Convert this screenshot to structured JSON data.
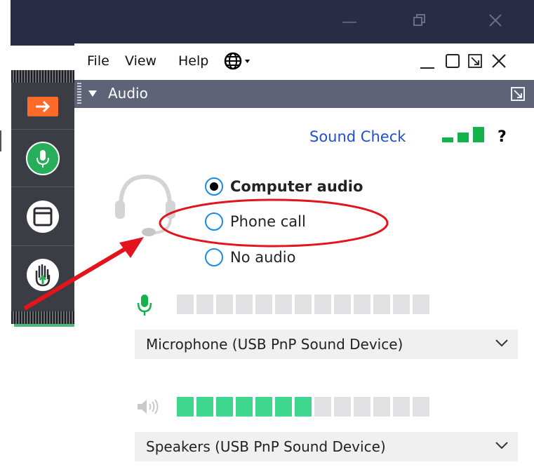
{
  "menu": {
    "file": "File",
    "view": "View",
    "help": "Help"
  },
  "panel": {
    "title": "Audio"
  },
  "sound_check": {
    "label": "Sound Check",
    "help": "?"
  },
  "audio_options": [
    {
      "label": "Computer audio",
      "selected": true
    },
    {
      "label": "Phone call",
      "selected": false
    },
    {
      "label": "No audio",
      "selected": false
    }
  ],
  "microphone": {
    "device": "Microphone (USB PnP Sound Device)",
    "level_segments_on": 0,
    "level_segments_total": 13
  },
  "speakers": {
    "device": "Speakers (USB PnP Sound Device)",
    "level_segments_on": 7,
    "level_segments_total": 13
  },
  "colors": {
    "accent_blue": "#1c8be6",
    "meter_green": "#3fd68d",
    "annotation_red": "#e3141b",
    "dock_orange": "#ff6a2b"
  }
}
